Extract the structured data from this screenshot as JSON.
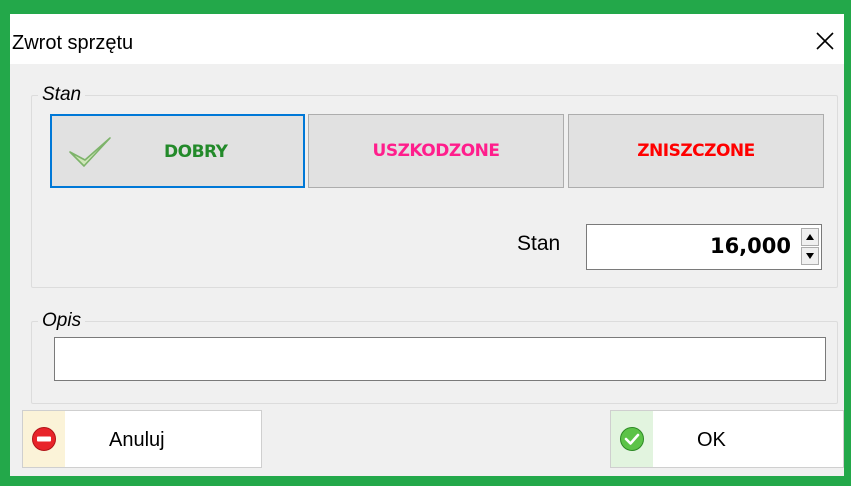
{
  "window": {
    "title": "Zwrot sprzętu",
    "close_icon": "close-icon"
  },
  "stan_group": {
    "legend": "Stan",
    "buttons": [
      {
        "label": "DOBRY",
        "color": "#238a2a",
        "icon": "check-icon",
        "selected": true
      },
      {
        "label": "USZKODZONE",
        "color": "#ff1e8c",
        "selected": false
      },
      {
        "label": "ZNISZCZONE",
        "color": "#ff0000",
        "selected": false
      }
    ],
    "field_label": "Stan",
    "field_value": "16,000"
  },
  "opis_group": {
    "legend": "Opis",
    "value": ""
  },
  "footer": {
    "cancel_label": "Anuluj",
    "cancel_icon": "no-entry-icon",
    "ok_label": "OK",
    "ok_icon": "ok-check-icon"
  },
  "colors": {
    "frame": "#23a84a",
    "selected_border": "#0078d7"
  }
}
